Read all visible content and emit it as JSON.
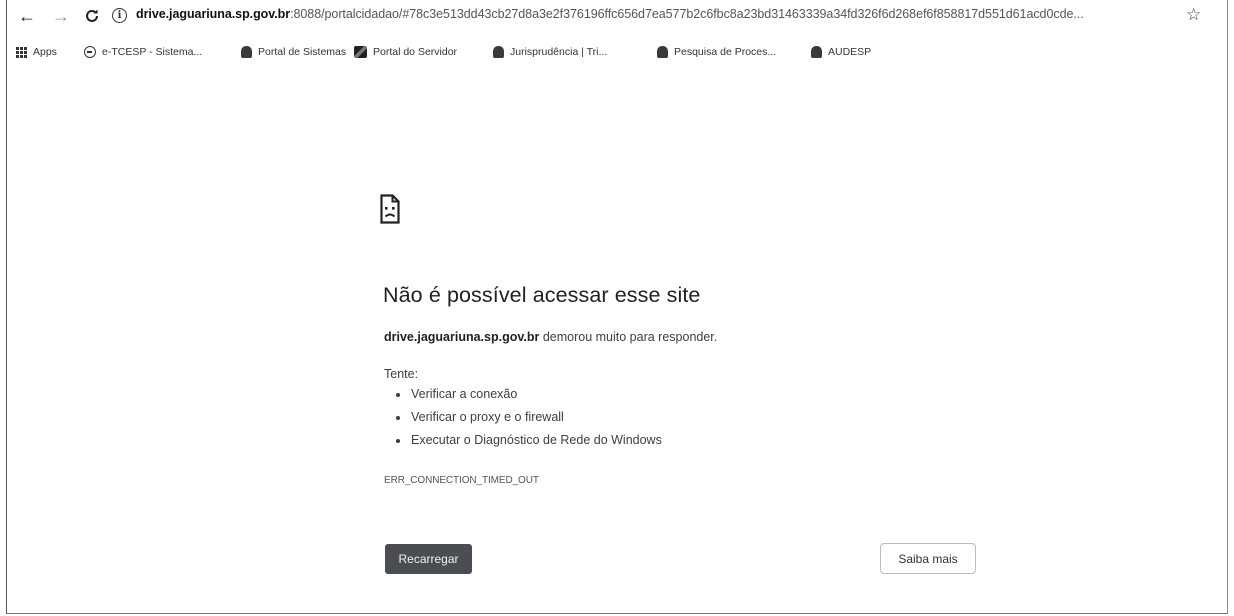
{
  "browser": {
    "url_host": "drive.jaguariuna.sp.gov.br",
    "url_rest": ":8088/portalcidadao/#78c3e513dd43cb27d8a3e2f376196ffc656d7ea577b2c6fbc8a23bd31463339a34fd326f6d268ef6f858817d551d61acd0cde..."
  },
  "bookmarks": [
    {
      "label": "Apps",
      "icon": "apps-grid-icon"
    },
    {
      "label": "e-TCESP - Sistema...",
      "icon": "globe-icon"
    },
    {
      "label": "Portal de Sistemas",
      "icon": "seal-icon"
    },
    {
      "label": "Portal do Servidor",
      "icon": "portal-icon"
    },
    {
      "label": "Jurisprudência | Tri...",
      "icon": "seal-icon"
    },
    {
      "label": "Pesquisa de Proces...",
      "icon": "seal-icon"
    },
    {
      "label": "AUDESP",
      "icon": "seal-icon"
    }
  ],
  "error": {
    "title": "Não é possível acessar esse site",
    "host": "drive.jaguariuna.sp.gov.br",
    "message": " demorou muito para responder.",
    "suggestions_heading": "Tente:",
    "suggestions": [
      "Verificar a conexão",
      "Verificar o proxy e o firewall",
      "Executar o Diagnóstico de Rede do Windows"
    ],
    "code": "ERR_CONNECTION_TIMED_OUT",
    "reload_label": "Recarregar",
    "more_label": "Saiba mais"
  },
  "colors": {
    "reload_button": "#4a4d51",
    "text": "#202124"
  }
}
